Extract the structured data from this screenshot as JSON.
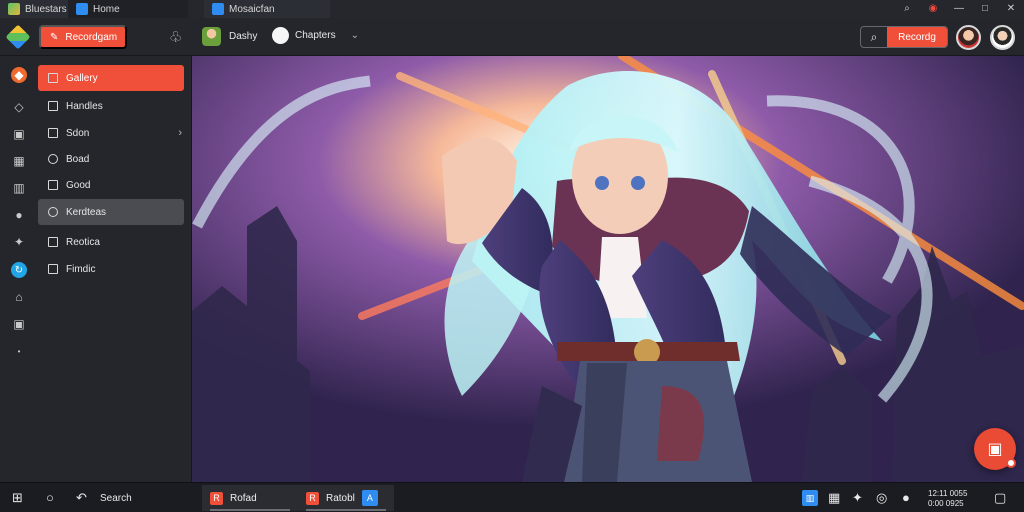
{
  "window": {
    "tabs": [
      {
        "label": "Bluestars"
      },
      {
        "label": "Home"
      },
      {
        "label": "Mosaicfan"
      }
    ]
  },
  "toolbar": {
    "primary_button": "Recordgam",
    "app_name": "Dashy",
    "app_menu": "Chapters",
    "search_action": "Recordg",
    "colors": {
      "accent": "#f0503a",
      "dark_bg": "#24262c"
    }
  },
  "sidebar": {
    "icons": [
      "home-icon",
      "compass-icon",
      "cube-icon",
      "calendar-icon",
      "building-icon",
      "user-icon",
      "puzzle-icon",
      "refresh-icon",
      "house-icon",
      "box-icon",
      "dot-icon"
    ],
    "items": [
      {
        "label": "Gallery",
        "state": "active",
        "icon": "square-icon"
      },
      {
        "label": "Handles",
        "state": "normal",
        "icon": "square-icon"
      },
      {
        "label": "Sdon",
        "state": "normal",
        "icon": "square-icon",
        "has_chevron": true
      },
      {
        "label": "Boad",
        "state": "normal",
        "icon": "circle-icon"
      },
      {
        "label": "Good",
        "state": "normal",
        "icon": "square-icon"
      },
      {
        "label": "Kerdteas",
        "state": "selected",
        "icon": "circle-icon"
      },
      {
        "label": "Reotica",
        "state": "normal",
        "icon": "square-icon"
      },
      {
        "label": "Fimdic",
        "state": "normal",
        "icon": "square-icon"
      }
    ]
  },
  "taskbar": {
    "search_label": "Search",
    "running_apps": [
      {
        "label": "Rofad"
      },
      {
        "label": "Ratobl"
      }
    ],
    "clock": {
      "time": "12:11 0055",
      "date": "0:00 0925"
    }
  }
}
